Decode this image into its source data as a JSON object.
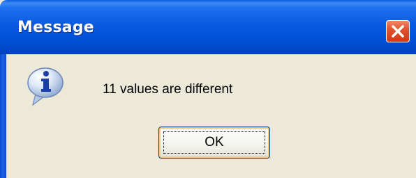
{
  "window": {
    "title": "Message",
    "colors": {
      "titlebar": "#0a5ae0",
      "body": "#ece9d8",
      "close_button": "#e2532f",
      "ok_focus_border": "#f7c57c"
    }
  },
  "titlebar": {
    "close_icon": "close-icon"
  },
  "dialog": {
    "icon": "info-icon",
    "message": "11 values are different",
    "ok_label": "OK"
  }
}
